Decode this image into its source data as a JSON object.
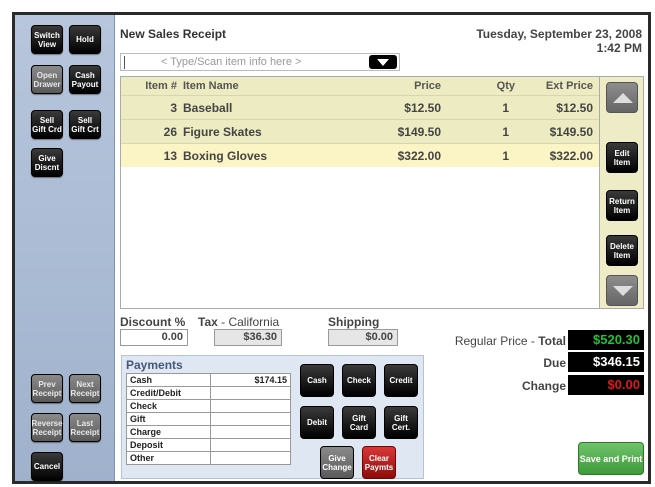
{
  "sidebar": {
    "switch_view": "Switch View",
    "hold": "Hold",
    "open_drawer": "Open Drawer",
    "cash_payout": "Cash Payout",
    "sell_gift_card": "Sell Gift Crd",
    "sell_gift_cert": "Sell Gift Crt",
    "give_discount": "Give Discnt",
    "prev_receipt": "Prev Receipt",
    "next_receipt": "Next Receipt",
    "reverse_receipt": "Reverse Receipt",
    "last_receipt": "Last Receipt",
    "cancel": "Cancel"
  },
  "header": {
    "title": "New Sales Receipt",
    "date": "Tuesday, September 23, 2008",
    "time": "1:42 PM"
  },
  "search": {
    "placeholder": "< Type/Scan item info here >"
  },
  "table": {
    "columns": {
      "item_no": "Item #",
      "item_name": "Item Name",
      "price": "Price",
      "qty": "Qty",
      "ext_price": "Ext Price"
    },
    "rows": [
      {
        "item_no": "3",
        "item_name": "Baseball",
        "price": "$12.50",
        "qty": "1",
        "ext_price": "$12.50"
      },
      {
        "item_no": "26",
        "item_name": "Figure Skates",
        "price": "$149.50",
        "qty": "1",
        "ext_price": "$149.50"
      },
      {
        "item_no": "13",
        "item_name": "Boxing Gloves",
        "price": "$322.00",
        "qty": "1",
        "ext_price": "$322.00"
      }
    ]
  },
  "row_actions": {
    "edit": "Edit Item",
    "return": "Return Item",
    "delete": "Delete Item"
  },
  "totals_inputs": {
    "discount_label": "Discount %",
    "discount_value": "0.00",
    "tax_label": "Tax",
    "tax_region": "- California",
    "tax_value": "$36.30",
    "shipping_label": "Shipping",
    "shipping_value": "$0.00"
  },
  "summary": {
    "regular_price_label": "Regular Price -",
    "total_label": "Total",
    "total_value": "$520.30",
    "due_label": "Due",
    "due_value": "$346.15",
    "change_label": "Change",
    "change_value": "$0.00"
  },
  "payments": {
    "title": "Payments",
    "rows": [
      {
        "method": "Cash",
        "amount": "$174.15"
      },
      {
        "method": "Credit/Debit",
        "amount": ""
      },
      {
        "method": "Check",
        "amount": ""
      },
      {
        "method": "Gift",
        "amount": ""
      },
      {
        "method": "Charge",
        "amount": ""
      },
      {
        "method": "Deposit",
        "amount": ""
      },
      {
        "method": "Other",
        "amount": ""
      }
    ],
    "buttons": {
      "cash": "Cash",
      "check": "Check",
      "credit": "Credit",
      "debit": "Debit",
      "gift_card": "Gift Card",
      "gift_cert": "Gift Cert.",
      "give_change": "Give Change",
      "clear_payments": "Clear Paymts"
    }
  },
  "save_print": "Save and Print",
  "colors": {
    "total": "#22c233",
    "due": "#ffffff",
    "change": "#e01818",
    "selected_row": "#fbf4c4",
    "row_bg": "#ecebc2"
  }
}
